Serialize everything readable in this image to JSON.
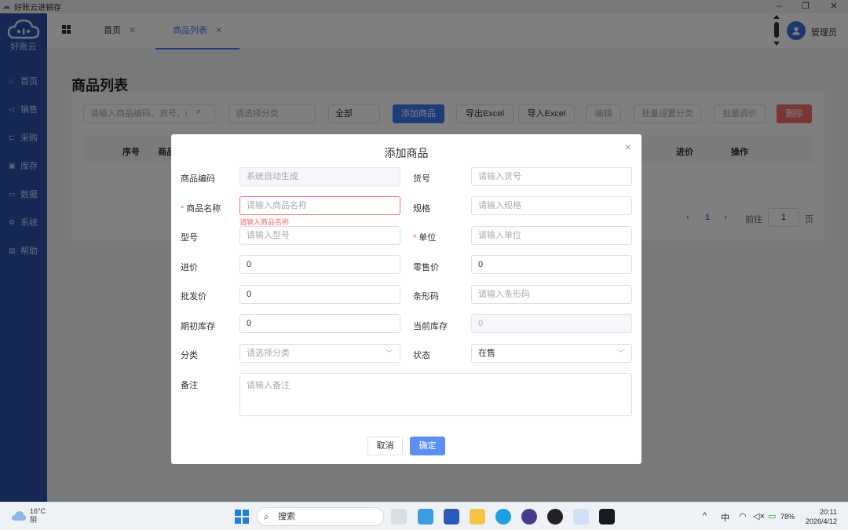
{
  "window": {
    "title": "好账云进销存",
    "minimize": "–",
    "maximize": "❐",
    "close": "✕"
  },
  "sidebar": {
    "logo_text": "好账云",
    "items": [
      {
        "icon": "home-icon",
        "glyph": "⌂",
        "label": "首页"
      },
      {
        "icon": "send-icon",
        "glyph": "◁",
        "label": "销售"
      },
      {
        "icon": "cart-icon",
        "glyph": "⊏",
        "label": "采购"
      },
      {
        "icon": "box-icon",
        "glyph": "▣",
        "label": "库存"
      },
      {
        "icon": "monitor-icon",
        "glyph": "▭",
        "label": "数据"
      },
      {
        "icon": "gear-icon",
        "glyph": "⚙",
        "label": "系统"
      },
      {
        "icon": "doc-icon",
        "glyph": "▤",
        "label": "帮助"
      }
    ]
  },
  "tabs": [
    {
      "label": "首页",
      "close": "✕"
    },
    {
      "label": "商品列表",
      "close": "✕"
    }
  ],
  "user": {
    "name": "管理员"
  },
  "page": {
    "title": "商品列表",
    "toolbar": {
      "search_placeholder": "请输入商品编码、货号、i",
      "category_placeholder": "请选择分类",
      "status_value": "全部",
      "add": "添加商品",
      "export": "导出Excel",
      "import": "导入Excel",
      "edit": "编辑",
      "batch_category": "批量设置分类",
      "batch_price": "批量调价",
      "delete": "删除"
    },
    "table_headers": {
      "index": "序号",
      "product": "商品",
      "cost": "进价",
      "action": "操作"
    },
    "pager": {
      "current": "1",
      "goto_label": "前往",
      "goto_value": "1",
      "page_unit": "页",
      "prev": "‹",
      "next": "›"
    }
  },
  "dialog": {
    "title": "添加商品",
    "close": "×",
    "fields": {
      "code": {
        "label": "商品编码",
        "placeholder": "系统自动生成"
      },
      "sku": {
        "label": "货号",
        "placeholder": "请输入货号"
      },
      "name": {
        "label": "商品名称",
        "required": "*",
        "placeholder": "请输入商品名称",
        "error": "请输入商品名称"
      },
      "spec": {
        "label": "规格",
        "placeholder": "请输入规格"
      },
      "model": {
        "label": "型号",
        "placeholder": "请输入型号"
      },
      "unit": {
        "label": "单位",
        "required": "*",
        "placeholder": "请输入单位"
      },
      "cost_price": {
        "label": "进价",
        "value": "0"
      },
      "retail_price": {
        "label": "零售价",
        "value": "0"
      },
      "wholesale_price": {
        "label": "批发价",
        "value": "0"
      },
      "barcode": {
        "label": "条形码",
        "placeholder": "请输入条形码"
      },
      "initial_stock": {
        "label": "期初库存",
        "value": "0"
      },
      "current_stock": {
        "label": "当前库存",
        "placeholder": "0"
      },
      "category": {
        "label": "分类",
        "placeholder": "请选择分类"
      },
      "status": {
        "label": "状态",
        "value": "在售"
      },
      "remark": {
        "label": "备注",
        "placeholder": "请输入备注"
      }
    },
    "cancel": "取消",
    "confirm": "确定"
  },
  "taskbar": {
    "weather_temp": "16°C",
    "weather_desc": "阴",
    "search_label": "搜索",
    "ime": "中",
    "battery": "78%",
    "time": "20:11",
    "date": "2026/4/12",
    "tray_up": "^"
  },
  "colors": {
    "sidebar": "#2f4ea8",
    "primary": "#3a78f2",
    "danger": "#f56c6c"
  }
}
